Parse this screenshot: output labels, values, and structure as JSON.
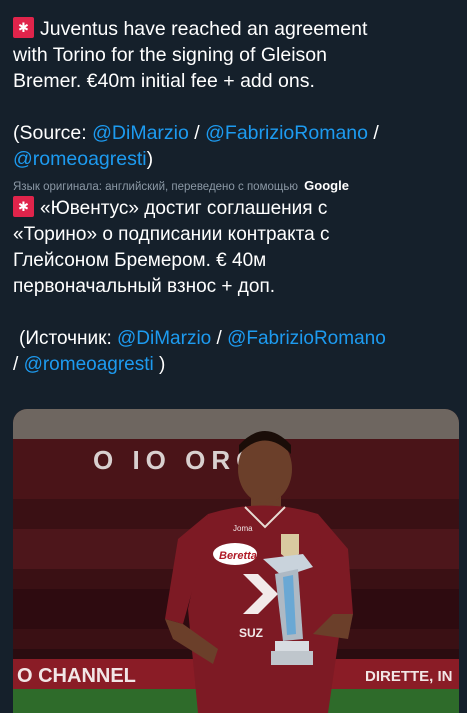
{
  "tweet": {
    "en": {
      "line1": "Juventus have reached an agreement",
      "line2": "with Torino for the signing of Gleison",
      "line3": "Bremer. €40m initial fee + add ons.",
      "source_prefix": "(Source: ",
      "sep": " / ",
      "mention1": "@DiMarzio",
      "mention2": "@FabrizioRomano",
      "mention3": "@romeoagresti",
      "close": ")"
    },
    "translation_note": "Язык оригинала: английский, переведено с помощью",
    "translation_brand": "Google",
    "ru": {
      "line1": "«Ювентус» достиг соглашения с",
      "line2": "«Торино» о подписании контракта с",
      "line3": "Глейсоном Бремером. € 40м",
      "line4": "первоначальный взнос + доп.",
      "source_prefix": "(Источник: ",
      "sep": " / ",
      "mention1": "@DiMarzio",
      "mention2": "@FabrizioRomano",
      "mention3": "@romeoagresti",
      "close": " )"
    },
    "siren_icon": "police-siren-emoji"
  },
  "photo": {
    "board_left": "O CHANNEL",
    "board_right": "DIRETTE, IN",
    "stand_text": "O IO ORO",
    "shirt_sponsor": "Beretta",
    "shirt_sleeve": "SUZ",
    "shirt_maker": "Joma",
    "colors": {
      "shirt": "#7d1a24",
      "stadium": "#3a1014",
      "grass": "#2e6b2a",
      "board": "#8a1c26"
    }
  }
}
